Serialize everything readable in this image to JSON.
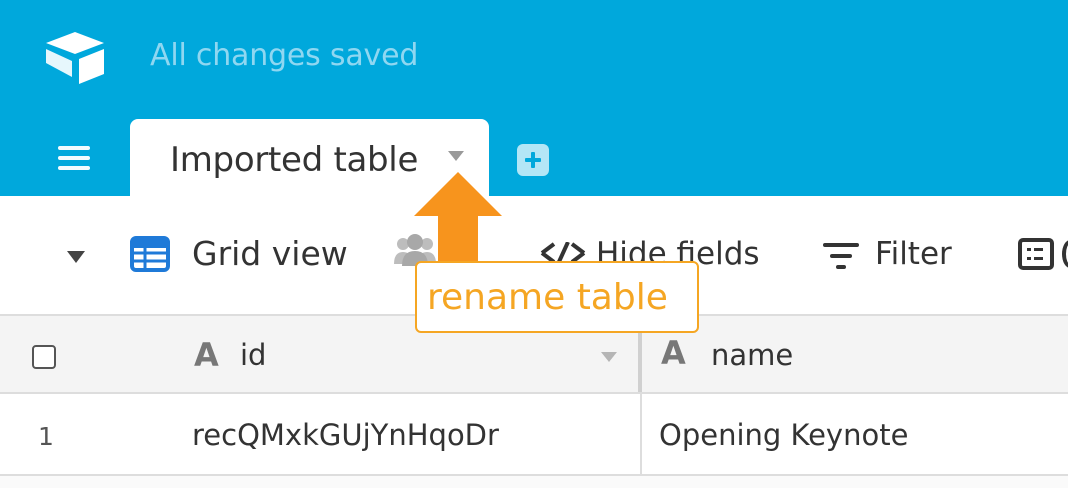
{
  "header": {
    "logo_icon": "airtable-logo-icon",
    "status": "All changes saved",
    "menu_icon": "hamburger-menu-icon",
    "table_tab": {
      "label": "Imported table",
      "caret_icon": "chevron-down-icon"
    },
    "add_table_icon": "plus-square-icon",
    "background_color": "#00a8dc"
  },
  "toolbar": {
    "view_switcher_icon": "chevron-down-icon",
    "view": {
      "icon": "grid-icon",
      "label": "Grid view"
    },
    "collaborators_icon": "people-icon",
    "hide_fields": {
      "icon": "eye-slash-icon",
      "label": "Hide fields"
    },
    "filter": {
      "icon": "filter-icon",
      "label": "Filter"
    },
    "group_icon": "group-list-icon"
  },
  "grid": {
    "columns": [
      {
        "type_icon": "A",
        "name": "id"
      },
      {
        "type_icon": "A",
        "name": "name"
      }
    ],
    "rows": [
      {
        "number": "1",
        "id": "recQMxkGUjYnHqoDr",
        "name": "Opening Keynote"
      }
    ]
  },
  "annotation": {
    "text": "rename table",
    "color": "#f5a623",
    "arrow_icon": "arrow-up-icon"
  }
}
